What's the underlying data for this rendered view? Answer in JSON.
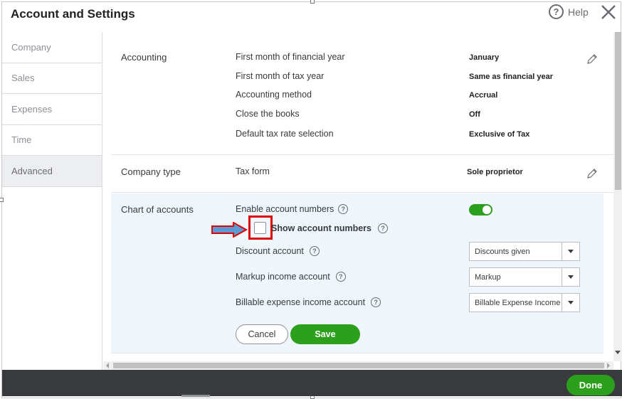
{
  "dialog": {
    "title": "Account and Settings",
    "help_label": "Help",
    "help_glyph": "?"
  },
  "sidebar": {
    "items": [
      {
        "label": "Company"
      },
      {
        "label": "Sales"
      },
      {
        "label": "Expenses"
      },
      {
        "label": "Time"
      },
      {
        "label": "Advanced",
        "active": true
      }
    ]
  },
  "accounting": {
    "title": "Accounting",
    "rows": [
      {
        "label": "First month of financial year",
        "value": "January"
      },
      {
        "label": "First month of tax year",
        "value": "Same as financial year"
      },
      {
        "label": "Accounting method",
        "value": "Accrual"
      },
      {
        "label": "Close the books",
        "value": "Off"
      },
      {
        "label": "Default tax rate selection",
        "value": "Exclusive of Tax"
      }
    ]
  },
  "company_type": {
    "title": "Company type",
    "label": "Tax form",
    "value": "Sole proprietor"
  },
  "chart_of_accounts": {
    "title": "Chart of accounts",
    "enable_numbers_label": "Enable account numbers",
    "enable_numbers_on": true,
    "show_numbers_label": "Show account numbers",
    "show_numbers_checked": false,
    "help_glyph": "?",
    "discount": {
      "label": "Discount account",
      "selected": "Discounts given"
    },
    "markup": {
      "label": "Markup income account",
      "selected": "Markup"
    },
    "billable": {
      "label": "Billable expense income account",
      "selected": "Billable Expense Income"
    },
    "cancel_label": "Cancel",
    "save_label": "Save"
  },
  "footer": {
    "done_label": "Done"
  },
  "colors": {
    "accent_green": "#2ca01c",
    "annotation_red": "#e10000",
    "annotation_blue": "#5b9bd5",
    "section_highlight": "#eff7fd",
    "footer_bg": "#393a3d"
  }
}
